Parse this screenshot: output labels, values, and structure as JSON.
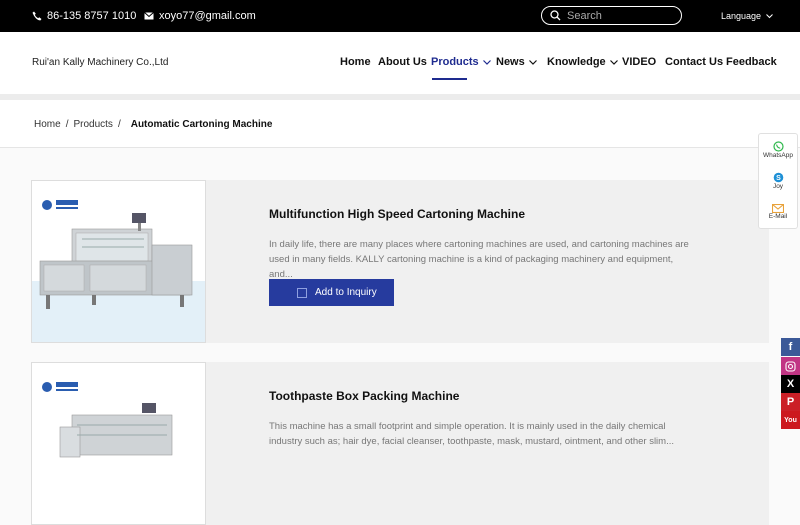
{
  "topbar": {
    "phone": "86-135 8757 1010",
    "email": "xoyo77@gmail.com",
    "search_placeholder": "Search",
    "language": "Language"
  },
  "header": {
    "brand": "Rui'an Kally Machinery Co.,Ltd",
    "nav": [
      {
        "label": "Home"
      },
      {
        "label": "About Us"
      },
      {
        "label": "Products"
      },
      {
        "label": "News"
      },
      {
        "label": "Knowledge"
      },
      {
        "label": "VIDEO"
      },
      {
        "label": "Contact Us"
      },
      {
        "label": "Feedback"
      }
    ]
  },
  "breadcrumb": {
    "home": "Home",
    "products": "Products",
    "current": "Automatic Cartoning Machine"
  },
  "products": [
    {
      "title": "Multifunction High Speed Cartoning Machine",
      "description": "In daily life, there are many places where cartoning machines are used, and cartoning machines are used in many fields. KALLY cartoning machine is a kind of packaging machinery and equipment, and...",
      "button": "Add to Inquiry",
      "logo_text": "KALLY MACHINE"
    },
    {
      "title": "Toothpaste Box Packing Machine",
      "description": "This machine has a small footprint and simple operation. It is mainly used in the daily chemical industry such as; hair dye, facial cleanser, toothpaste, mask, mustard, ointment, and other slim...",
      "logo_text": "KALLY MACHINE"
    }
  ],
  "float_contact": {
    "whatsapp": "WhatsApp",
    "skype": "Joy",
    "email": "E-Mail"
  },
  "social": {
    "facebook_color": "#3b5998",
    "instagram_color": "#c13584",
    "x_color": "#000000",
    "pinterest_color": "#cb2027",
    "youtube_color": "#cc181e",
    "youtube_label": "You"
  },
  "colors": {
    "accent": "#1e2b8f",
    "button": "#263b9e"
  }
}
